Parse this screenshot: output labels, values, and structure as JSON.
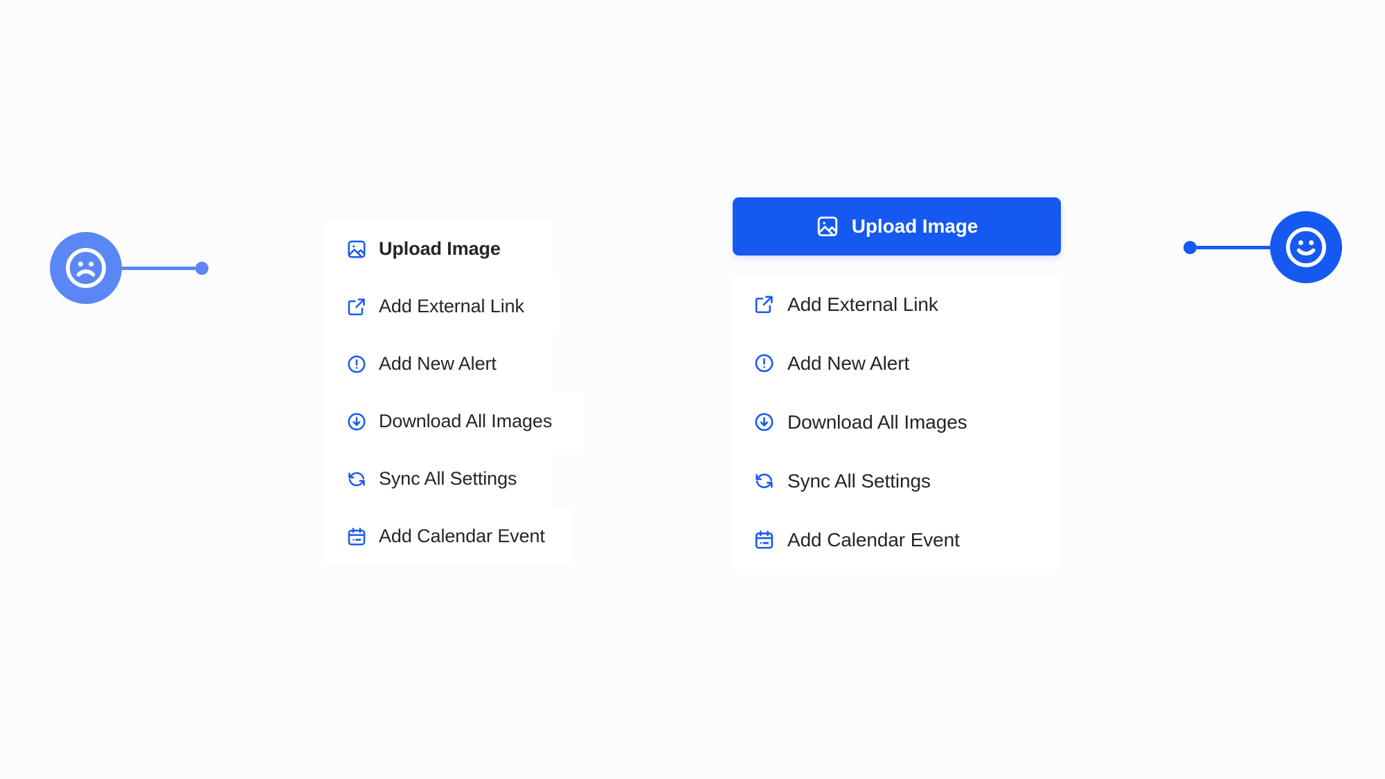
{
  "page": {
    "background_color": "#fcfcfd",
    "accent_color": "#1559f0",
    "muted_accent_color": "#5b86f5",
    "text_color": "#22252a"
  },
  "markers": {
    "before": {
      "face": "sad-face",
      "color": "#5b86f5"
    },
    "after": {
      "face": "happy-face",
      "color": "#1559f0"
    }
  },
  "before": {
    "label": "before-variant",
    "items": [
      {
        "label": "Upload Image",
        "icon": "image-icon",
        "primary": true
      },
      {
        "label": "Add External Link",
        "icon": "external-link-icon",
        "primary": false
      },
      {
        "label": "Add New Alert",
        "icon": "alert-circle-icon",
        "primary": false
      },
      {
        "label": "Download All Images",
        "icon": "download-circle-icon",
        "primary": false
      },
      {
        "label": "Sync All Settings",
        "icon": "sync-icon",
        "primary": false
      },
      {
        "label": "Add Calendar Event",
        "icon": "calendar-icon",
        "primary": false
      }
    ]
  },
  "after": {
    "label": "after-variant",
    "cta": {
      "label": "Upload Image",
      "icon": "image-icon",
      "background_color": "#1559f0",
      "text_color": "#ffffff"
    },
    "items": [
      {
        "label": "Add External Link",
        "icon": "external-link-icon"
      },
      {
        "label": "Add New Alert",
        "icon": "alert-circle-icon"
      },
      {
        "label": "Download All Images",
        "icon": "download-circle-icon"
      },
      {
        "label": "Sync All Settings",
        "icon": "sync-icon"
      },
      {
        "label": "Add Calendar Event",
        "icon": "calendar-icon"
      }
    ]
  }
}
